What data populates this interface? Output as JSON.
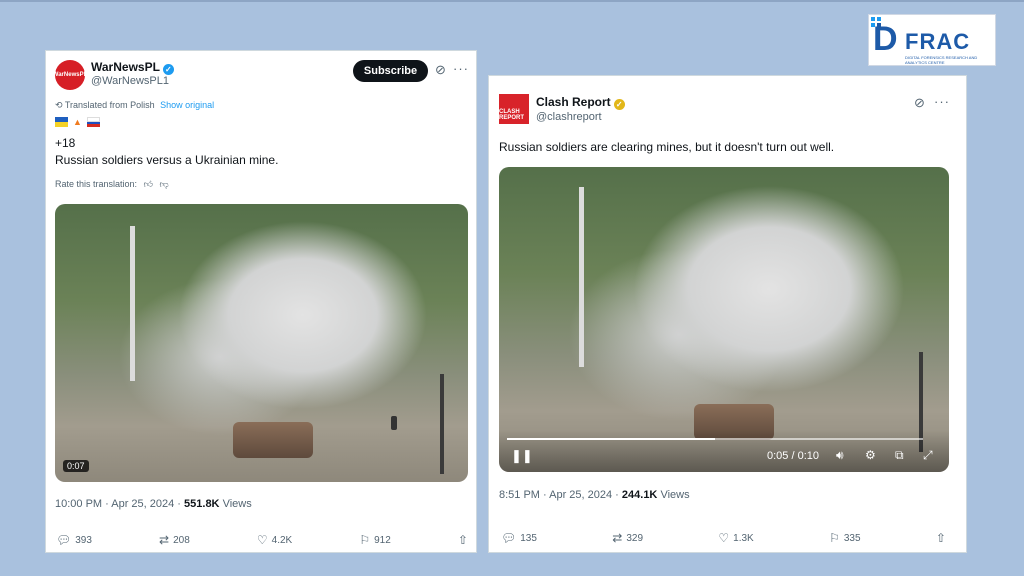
{
  "logo": {
    "word": "FRAC",
    "mark": "D",
    "tagline": "DIGITAL FORENSICS RESEARCH AND ANALYTICS CENTRE"
  },
  "post1": {
    "avatar_text": "WarNewsPL",
    "name": "WarNewsPL",
    "handle": "@WarNewsPL1",
    "subscribe_label": "Subscribe",
    "translated_text": "Translated from Polish",
    "show_original": "Show original",
    "flags": [
      "ukraine-flag",
      "fire-emoji",
      "russia-flag"
    ],
    "age_label": "+18",
    "body": "Russian soldiers versus a Ukrainian mine.",
    "rate_label": "Rate this translation:",
    "video_time": "0:07",
    "timestamp": "10:00 PM · Apr 25, 2024 · ",
    "views_count": "551.8K",
    "views_label": " Views",
    "replies": "393",
    "reposts": "208",
    "likes": "4.2K",
    "bookmarks": "912"
  },
  "post2": {
    "avatar_text": "CLASH REPORT",
    "name": "Clash Report",
    "handle": "@clashreport",
    "body": "Russian soldiers are clearing mines, but it doesn't turn out well.",
    "video_time": "0:05 / 0:10",
    "video_progress": 0.5,
    "timestamp": "8:51 PM · Apr 25, 2024 · ",
    "views_count": "244.1K",
    "views_label": " Views",
    "replies": "135",
    "reposts": "329",
    "likes": "1.3K",
    "bookmarks": "335"
  },
  "colors": {
    "background": "#a9c1de",
    "accent": "#1d9bf0",
    "verified_gold": "#e2b719",
    "text": "#0f1419"
  }
}
